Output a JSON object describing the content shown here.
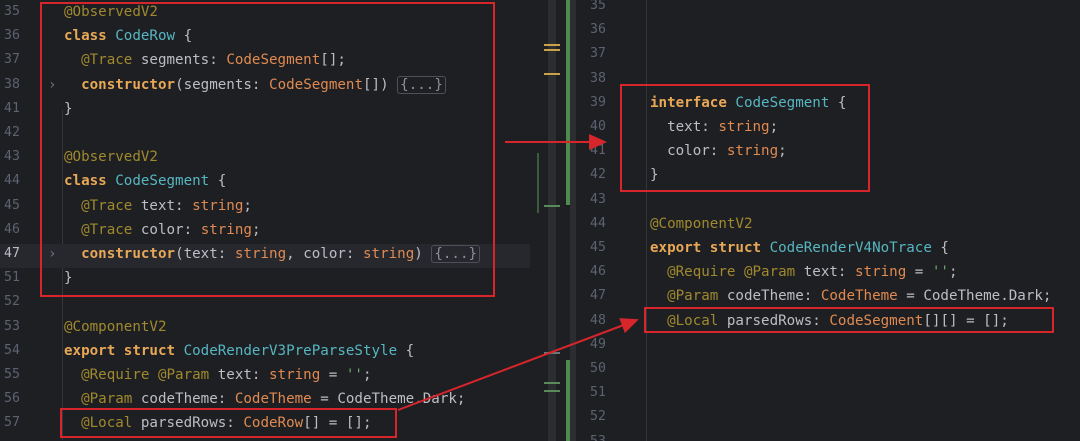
{
  "left": {
    "lines": [
      {
        "n": "35",
        "segs": [
          [
            "ann",
            "@ObservedV2"
          ]
        ]
      },
      {
        "n": "36",
        "segs": [
          [
            "kw",
            "class "
          ],
          [
            "cls",
            "CodeRow"
          ],
          [
            "",
            " {"
          ]
        ]
      },
      {
        "n": "37",
        "segs": [
          [
            "",
            "  "
          ],
          [
            "ann",
            "@Trace"
          ],
          [
            "",
            " segments: "
          ],
          [
            "ty",
            "CodeSegment"
          ],
          [
            "",
            "[];"
          ]
        ]
      },
      {
        "n": "38",
        "segs": [
          [
            "",
            "  "
          ],
          [
            "kw",
            "constructor"
          ],
          [
            "",
            "(segments: "
          ],
          [
            "ty",
            "CodeSegment"
          ],
          [
            "",
            "[]) "
          ],
          [
            "fb",
            "{...}"
          ]
        ],
        "fold": true
      },
      {
        "n": "41",
        "segs": [
          [
            "",
            "}"
          ]
        ]
      },
      {
        "n": "42",
        "segs": []
      },
      {
        "n": "43",
        "segs": [
          [
            "ann",
            "@ObservedV2"
          ]
        ]
      },
      {
        "n": "44",
        "segs": [
          [
            "kw",
            "class "
          ],
          [
            "cls",
            "CodeSegment"
          ],
          [
            "",
            " {"
          ]
        ]
      },
      {
        "n": "45",
        "segs": [
          [
            "",
            "  "
          ],
          [
            "ann",
            "@Trace"
          ],
          [
            "",
            " text: "
          ],
          [
            "ty",
            "string"
          ],
          [
            "",
            ";"
          ]
        ]
      },
      {
        "n": "46",
        "segs": [
          [
            "",
            "  "
          ],
          [
            "ann",
            "@Trace"
          ],
          [
            "",
            " color: "
          ],
          [
            "ty",
            "string"
          ],
          [
            "",
            ";"
          ]
        ]
      },
      {
        "n": "47",
        "segs": [
          [
            "",
            "  "
          ],
          [
            "kw",
            "constructor"
          ],
          [
            "",
            "(text: "
          ],
          [
            "ty",
            "string"
          ],
          [
            "",
            ", color: "
          ],
          [
            "ty",
            "string"
          ],
          [
            "",
            ") "
          ],
          [
            "fb",
            "{...}"
          ]
        ],
        "fold": true,
        "current": true
      },
      {
        "n": "51",
        "segs": [
          [
            "",
            "}"
          ]
        ]
      },
      {
        "n": "52",
        "segs": []
      },
      {
        "n": "53",
        "segs": [
          [
            "ann",
            "@ComponentV2"
          ]
        ]
      },
      {
        "n": "54",
        "segs": [
          [
            "kw",
            "export struct "
          ],
          [
            "cls",
            "CodeRenderV3PreParseStyle"
          ],
          [
            "",
            " {"
          ]
        ]
      },
      {
        "n": "55",
        "segs": [
          [
            "",
            "  "
          ],
          [
            "ann",
            "@Require @Param"
          ],
          [
            "",
            " text: "
          ],
          [
            "ty",
            "string"
          ],
          [
            "",
            " = "
          ],
          [
            "str",
            "''"
          ],
          [
            "",
            ";"
          ]
        ]
      },
      {
        "n": "56",
        "segs": [
          [
            "",
            "  "
          ],
          [
            "ann",
            "@Param"
          ],
          [
            "",
            " codeTheme: "
          ],
          [
            "ty",
            "CodeTheme"
          ],
          [
            "",
            " = CodeTheme.Dark;"
          ]
        ]
      },
      {
        "n": "57",
        "segs": [
          [
            "",
            "  "
          ],
          [
            "ann",
            "@Local"
          ],
          [
            "",
            " parsedRows: "
          ],
          [
            "ty",
            "CodeRow"
          ],
          [
            "",
            "[] = [];"
          ]
        ]
      },
      {
        "n": "58",
        "segs": []
      }
    ]
  },
  "right": {
    "lines": [
      {
        "n": "35",
        "segs": []
      },
      {
        "n": "36",
        "segs": []
      },
      {
        "n": "37",
        "segs": []
      },
      {
        "n": "38",
        "segs": []
      },
      {
        "n": "39",
        "segs": [
          [
            "kw",
            "interface "
          ],
          [
            "cls",
            "CodeSegment"
          ],
          [
            "",
            " {"
          ]
        ]
      },
      {
        "n": "40",
        "segs": [
          [
            "",
            "  text: "
          ],
          [
            "ty",
            "string"
          ],
          [
            "",
            ";"
          ]
        ]
      },
      {
        "n": "41",
        "segs": [
          [
            "",
            "  color: "
          ],
          [
            "ty",
            "string"
          ],
          [
            "",
            ";"
          ]
        ]
      },
      {
        "n": "42",
        "segs": [
          [
            "",
            "}"
          ]
        ]
      },
      {
        "n": "43",
        "segs": []
      },
      {
        "n": "44",
        "segs": [
          [
            "ann",
            "@ComponentV2"
          ]
        ]
      },
      {
        "n": "45",
        "segs": [
          [
            "kw",
            "export struct "
          ],
          [
            "cls",
            "CodeRenderV4NoTrace"
          ],
          [
            "",
            " {"
          ]
        ]
      },
      {
        "n": "46",
        "segs": [
          [
            "",
            "  "
          ],
          [
            "ann",
            "@Require @Param"
          ],
          [
            "",
            " text: "
          ],
          [
            "ty",
            "string"
          ],
          [
            "",
            " = "
          ],
          [
            "str",
            "''"
          ],
          [
            "",
            ";"
          ]
        ]
      },
      {
        "n": "47",
        "segs": [
          [
            "",
            "  "
          ],
          [
            "ann",
            "@Param"
          ],
          [
            "",
            " codeTheme: "
          ],
          [
            "ty",
            "CodeTheme"
          ],
          [
            "",
            " = CodeTheme.Dark;"
          ]
        ]
      },
      {
        "n": "48",
        "segs": [
          [
            "",
            "  "
          ],
          [
            "ann",
            "@Local"
          ],
          [
            "",
            " parsedRows: "
          ],
          [
            "ty",
            "CodeSegment"
          ],
          [
            "",
            "[][] = [];"
          ]
        ]
      },
      {
        "n": "49",
        "segs": []
      },
      {
        "n": "50",
        "segs": []
      },
      {
        "n": "51",
        "segs": []
      },
      {
        "n": "52",
        "segs": []
      },
      {
        "n": "53",
        "segs": []
      }
    ]
  },
  "colors": {
    "annotation_box": "#d6262c",
    "arrow": "#d6262c",
    "keyword": "#e8a857",
    "class_name": "#56b6c2",
    "type": "#e08a52",
    "annotation": "#a0892e",
    "string": "#6aab73"
  }
}
